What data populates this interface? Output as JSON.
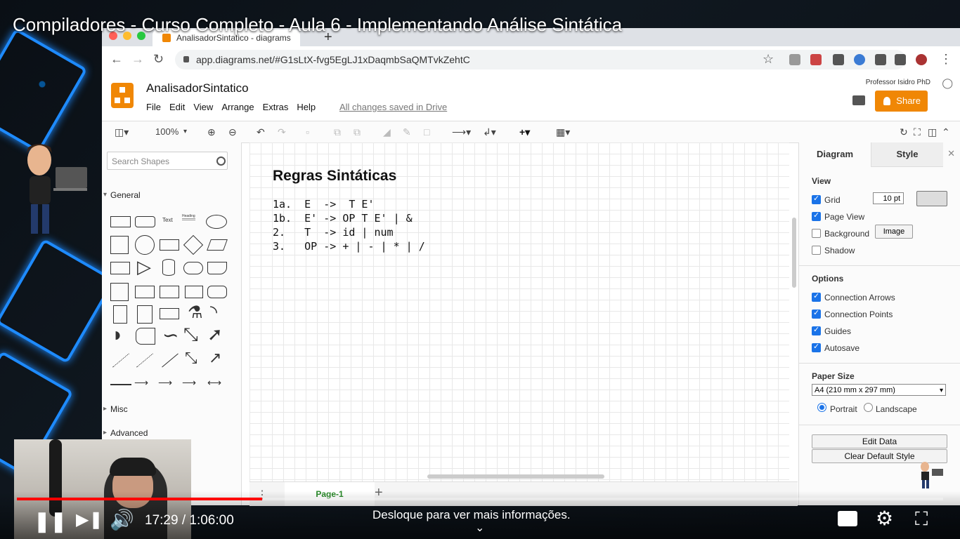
{
  "video": {
    "title": "Compiladores - Curso Completo - Aula 6 - Implementando Análise Sintática",
    "time": "17:29 / 1:06:00",
    "hint": "Desloque para ver mais informações.",
    "progress_fraction": 0.265
  },
  "browser": {
    "tab_title": "AnalisadorSintatico - diagrams",
    "url": "app.diagrams.net/#G1sLtX-fvg5EgLJ1xDaqmbSaQMTvkZehtC"
  },
  "app": {
    "doc_title": "AnalisadorSintatico",
    "menu": [
      "File",
      "Edit",
      "View",
      "Arrange",
      "Extras",
      "Help"
    ],
    "saved_status": "All changes saved in Drive",
    "user": "Professor Isidro PhD",
    "share_label": "Share"
  },
  "toolbar": {
    "zoom": "100%"
  },
  "sidebar": {
    "search_placeholder": "Search Shapes",
    "general_label": "General",
    "misc_label": "Misc",
    "advanced_label": "Advanced",
    "text_shape": "Text",
    "heading_shape": "Heading"
  },
  "canvas": {
    "title": "Regras Sintáticas",
    "rules": [
      "1a.  E  ->  T E'",
      "1b.  E' -> OP T E' | &",
      "2.   T  -> id | num",
      "3.   OP -> + | - | * | /"
    ],
    "page_tab": "Page-1"
  },
  "panel": {
    "tab_diagram": "Diagram",
    "tab_style": "Style",
    "view_header": "View",
    "grid_label": "Grid",
    "grid_size": "10 pt",
    "page_view_label": "Page View",
    "background_label": "Background",
    "image_button": "Image",
    "shadow_label": "Shadow",
    "options_header": "Options",
    "connection_arrows": "Connection Arrows",
    "connection_points": "Connection Points",
    "guides": "Guides",
    "autosave": "Autosave",
    "paper_size_header": "Paper Size",
    "paper_size": "A4 (210 mm x 297 mm)",
    "portrait": "Portrait",
    "landscape": "Landscape",
    "edit_data": "Edit Data",
    "clear_default_style": "Clear Default Style"
  }
}
